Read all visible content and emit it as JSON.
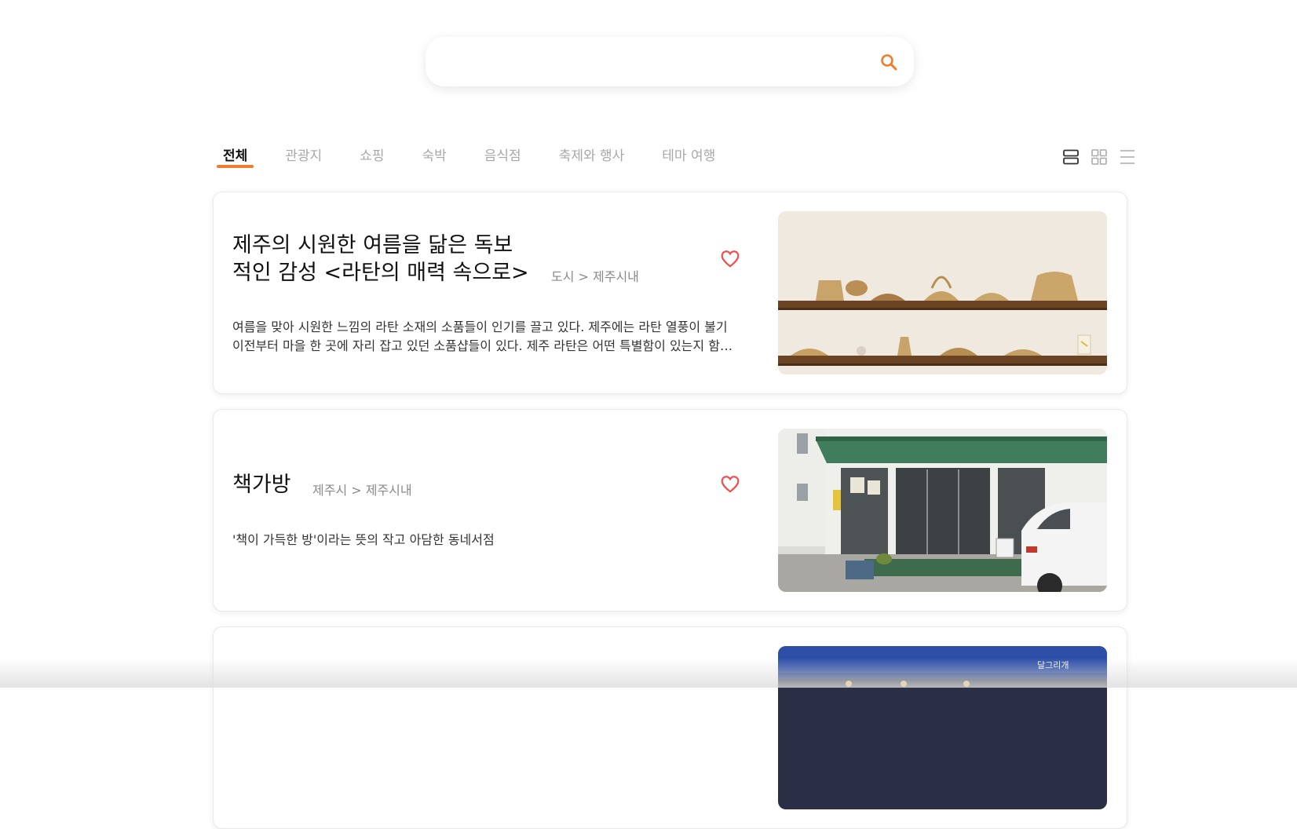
{
  "search": {
    "placeholder": "",
    "value": "",
    "icon": "search-icon",
    "accent": "#ef7d2b"
  },
  "tabs": [
    {
      "label": "전체",
      "active": true
    },
    {
      "label": "관광지",
      "active": false
    },
    {
      "label": "쇼핑",
      "active": false
    },
    {
      "label": "숙박",
      "active": false
    },
    {
      "label": "음식점",
      "active": false
    },
    {
      "label": "축제와 행사",
      "active": false
    },
    {
      "label": "테마 여행",
      "active": false
    }
  ],
  "view_toggles": [
    {
      "icon": "list-large-icon",
      "active": true
    },
    {
      "icon": "grid-icon",
      "active": false
    },
    {
      "icon": "list-compact-icon",
      "active": false
    }
  ],
  "cards": [
    {
      "title": "제주의 시원한 여름을 닮은 독보\n적인 감성 <라탄의 매력 속으로>",
      "location": "도시 > 제주시내",
      "description": "여름을 맞아 시원한 느낌의 라탄 소재의 소품들이 인기를 끌고 있다. 제주에는 라탄 열풍이 불기 이전부터 마을 한 곳에 자리 잡고 있던 소품샵들이 있다. 제주 라탄은 어떤 특별함이 있는지 함께 구...",
      "heart_icon": "heart-outline-icon",
      "image": "rattan-shelves-photo"
    },
    {
      "title": "책가방",
      "location": "제주시 > 제주시내",
      "description": "'책이 가득한 방'이라는 뜻의 작고 아담한 동네서점",
      "heart_icon": "heart-outline-icon",
      "image": "bookstore-storefront-photo"
    },
    {
      "title": "",
      "location": "",
      "description": "",
      "heart_icon": "",
      "image": "blue-awning-shop-photo",
      "image_sign_text": "달그리개"
    }
  ],
  "colors": {
    "accent": "#ef7d2b",
    "tab_inactive": "#a8a8a8",
    "location_text": "#8a8a8a"
  }
}
